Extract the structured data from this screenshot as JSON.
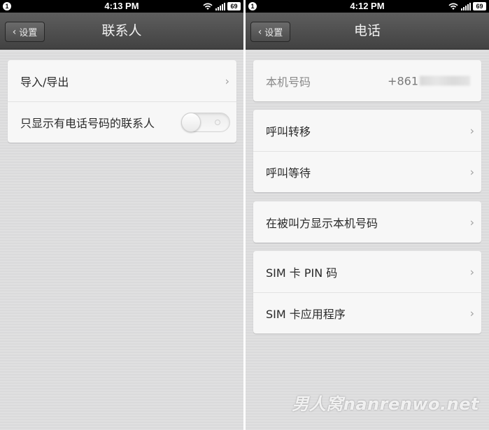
{
  "left_screen": {
    "status": {
      "notification_count": "1",
      "time": "4:13 PM",
      "battery": "69"
    },
    "nav": {
      "back_label": "设置",
      "title": "联系人"
    },
    "rows": {
      "import_export": "导入/导出",
      "show_with_phone": "只显示有电话号码的联系人"
    },
    "toggle_state": "off"
  },
  "right_screen": {
    "status": {
      "notification_count": "1",
      "time": "4:12 PM",
      "battery": "69"
    },
    "nav": {
      "back_label": "设置",
      "title": "电话"
    },
    "my_number": {
      "label": "本机号码",
      "value_visible": "+861"
    },
    "rows": {
      "call_forwarding": "呼叫转移",
      "call_waiting": "呼叫等待",
      "show_my_number": "在被叫方显示本机号码",
      "sim_pin": "SIM 卡 PIN 码",
      "sim_apps": "SIM 卡应用程序"
    }
  },
  "watermark": "男人窝nanrenwo.net",
  "icons": {
    "back": "chevron-left-icon",
    "row_arrow": "chevron-right-icon",
    "wifi": "wifi-icon",
    "signal": "signal-icon",
    "battery": "battery-icon",
    "notification": "notification-badge-icon"
  }
}
